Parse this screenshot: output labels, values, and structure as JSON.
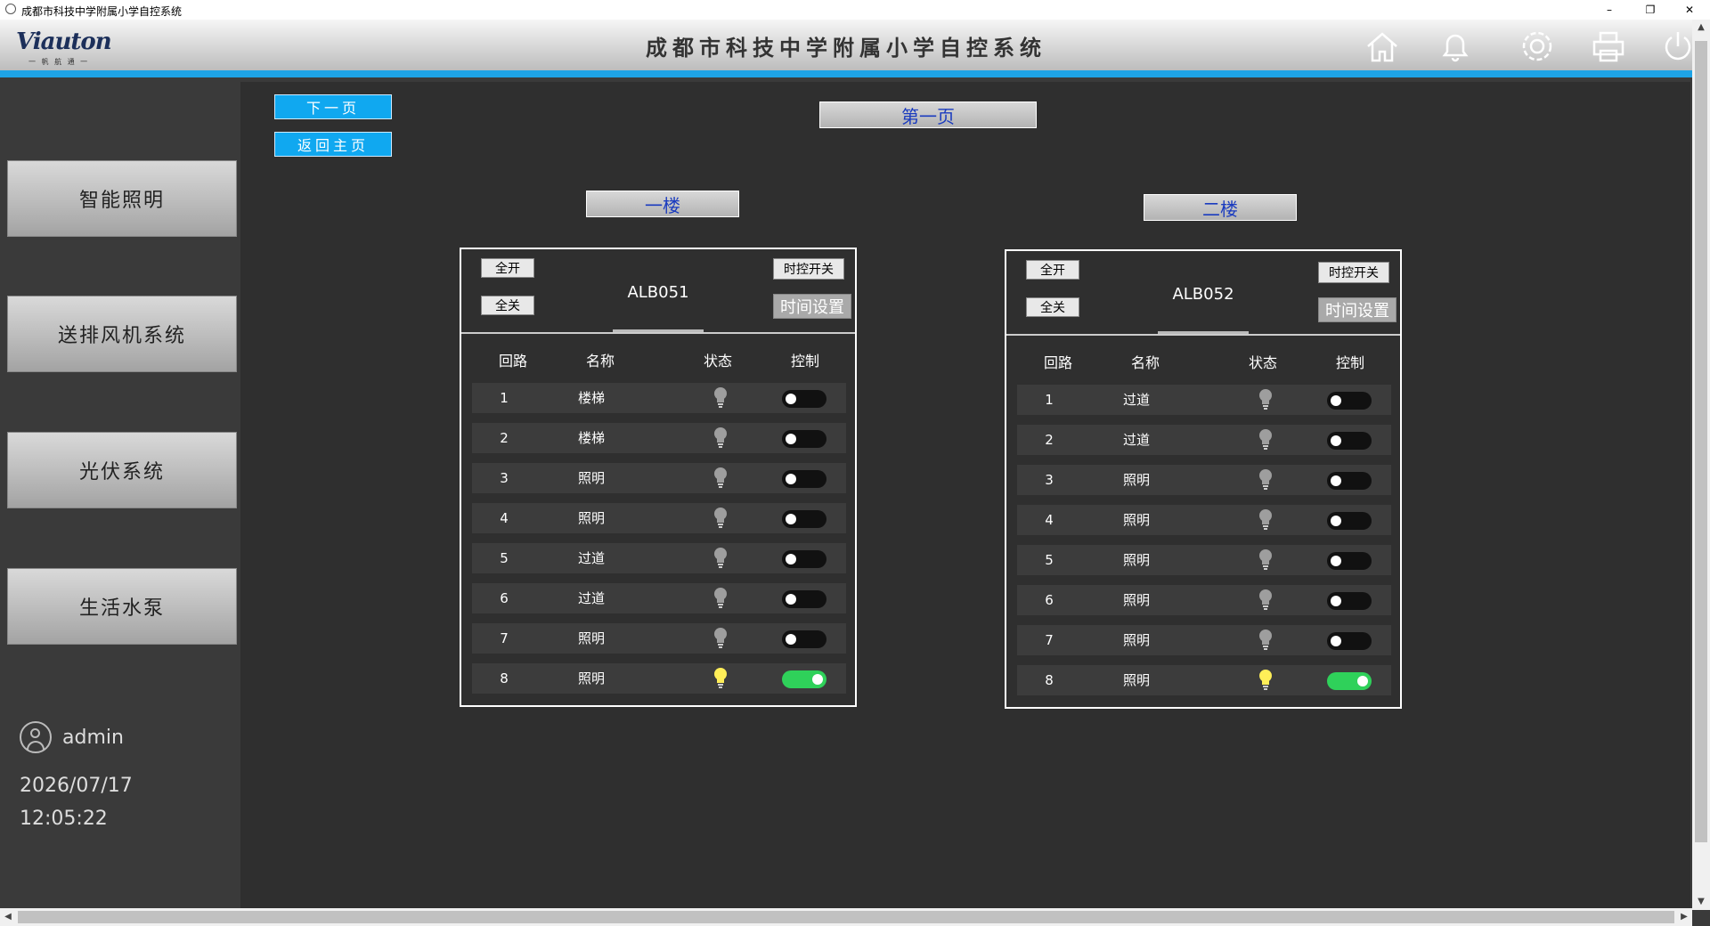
{
  "window": {
    "title": "成都市科技中学附属小学自控系统",
    "min": "–",
    "restore": "❐",
    "close": "✕"
  },
  "header": {
    "logo": "Viauton",
    "logo_sub": "一 帆 航 通 一",
    "title": "成都市科技中学附属小学自控系统",
    "icons": [
      "home-icon",
      "bell-icon",
      "gear-icon",
      "printer-icon",
      "power-icon"
    ]
  },
  "sidebar": {
    "items": [
      "智能照明",
      "送排风机系统",
      "光伏系统",
      "生活水泵"
    ],
    "user": "admin",
    "date": "2026/07/17",
    "time": "12:05:22"
  },
  "main": {
    "next_page": "下一页",
    "back_home": "返回主页",
    "page_label": "第一页",
    "floors": [
      "一楼",
      "二楼"
    ]
  },
  "panels": [
    {
      "device": "ALB051",
      "all_on": "全开",
      "all_off": "全关",
      "timer_switch": "时控开关",
      "time_set": "时间设置",
      "headers": [
        "回路",
        "名称",
        "状态",
        "控制"
      ],
      "rows": [
        {
          "n": "1",
          "name": "楼梯",
          "on": false
        },
        {
          "n": "2",
          "name": "楼梯",
          "on": false
        },
        {
          "n": "3",
          "name": "照明",
          "on": false
        },
        {
          "n": "4",
          "name": "照明",
          "on": false
        },
        {
          "n": "5",
          "name": "过道",
          "on": false
        },
        {
          "n": "6",
          "name": "过道",
          "on": false
        },
        {
          "n": "7",
          "name": "照明",
          "on": false
        },
        {
          "n": "8",
          "name": "照明",
          "on": true
        }
      ]
    },
    {
      "device": "ALB052",
      "all_on": "全开",
      "all_off": "全关",
      "timer_switch": "时控开关",
      "time_set": "时间设置",
      "headers": [
        "回路",
        "名称",
        "状态",
        "控制"
      ],
      "rows": [
        {
          "n": "1",
          "name": "过道",
          "on": false
        },
        {
          "n": "2",
          "name": "过道",
          "on": false
        },
        {
          "n": "3",
          "name": "照明",
          "on": false
        },
        {
          "n": "4",
          "name": "照明",
          "on": false
        },
        {
          "n": "5",
          "name": "照明",
          "on": false
        },
        {
          "n": "6",
          "name": "照明",
          "on": false
        },
        {
          "n": "7",
          "name": "照明",
          "on": false
        },
        {
          "n": "8",
          "name": "照明",
          "on": true
        }
      ]
    }
  ],
  "colors": {
    "accent": "#1ea3e6",
    "toggle_on": "#2fd15a",
    "bulb_on": "#ffee58",
    "bulb_off": "#9e9e9e"
  }
}
